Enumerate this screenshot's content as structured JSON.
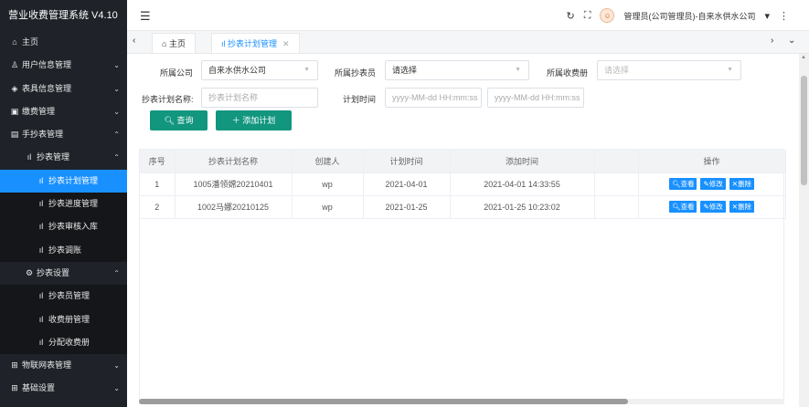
{
  "app": {
    "title": "营业收费管理系统 V4.10"
  },
  "sidebar": {
    "items": [
      {
        "label": "主页",
        "icon": "home-icon"
      },
      {
        "label": "用户信息管理",
        "icon": "user-icon"
      },
      {
        "label": "表具信息管理",
        "icon": "meter-icon"
      },
      {
        "label": "缴费管理",
        "icon": "payment-icon"
      },
      {
        "label": "手抄表管理",
        "icon": "document-icon"
      },
      {
        "label": "抄表管理",
        "icon": "bar-chart-icon"
      },
      {
        "label": "抄表计划管理",
        "icon": "bar-chart-icon"
      },
      {
        "label": "抄表进度管理",
        "icon": "bar-chart-icon"
      },
      {
        "label": "抄表审核入库",
        "icon": "bar-chart-icon"
      },
      {
        "label": "抄表调账",
        "icon": "bar-chart-icon"
      },
      {
        "label": "抄表设置",
        "icon": "gear-icon"
      },
      {
        "label": "抄表员管理",
        "icon": "bar-chart-icon"
      },
      {
        "label": "收费册管理",
        "icon": "bar-chart-icon"
      },
      {
        "label": "分配收费册",
        "icon": "bar-chart-icon"
      },
      {
        "label": "物联网表管理",
        "icon": "grid-icon"
      },
      {
        "label": "基础设置",
        "icon": "grid-icon"
      }
    ]
  },
  "header": {
    "user": "管理员(公司管理员)-自来水供水公司",
    "icons": [
      "menu-icon",
      "refresh-icon",
      "fullscreen-icon",
      "avatar",
      "more-icon"
    ]
  },
  "tabs": [
    {
      "label": "主页"
    },
    {
      "label": "抄表计划管理"
    }
  ],
  "filters": {
    "company_label": "所属公司",
    "company_value": "自来水供水公司",
    "reader_label": "所属抄表员",
    "reader_value": "请选择",
    "book_label": "所属收费册",
    "book_placeholder": "请选择",
    "plan_name_label": "抄表计划名称:",
    "plan_name_placeholder": "抄表计划名称",
    "plan_time_label": "计划时间",
    "time_start_placeholder": "yyyy-MM-dd HH:mm:ss",
    "time_end_placeholder": "yyyy-MM-dd HH:mm:ss",
    "query_button": "查询",
    "add_button": "添加计划"
  },
  "table": {
    "columns": [
      "序号",
      "抄表计划名称",
      "创建人",
      "计划时间",
      "添加时间",
      "",
      "操作"
    ],
    "rows": [
      [
        "1",
        "1005潘领嫦20210401",
        "wp",
        "2021-04-01",
        "2021-04-01 14:33:55"
      ],
      [
        "2",
        "1002马娜20210125",
        "wp",
        "2021-01-25",
        "2021-01-25 10:23:02"
      ]
    ],
    "actions": {
      "view": "查看",
      "edit": "修改",
      "delete": "删除"
    }
  },
  "colors": {
    "sidebar_bg": "#1f2329",
    "accent": "#1890ff",
    "button_green": "#12967e"
  }
}
